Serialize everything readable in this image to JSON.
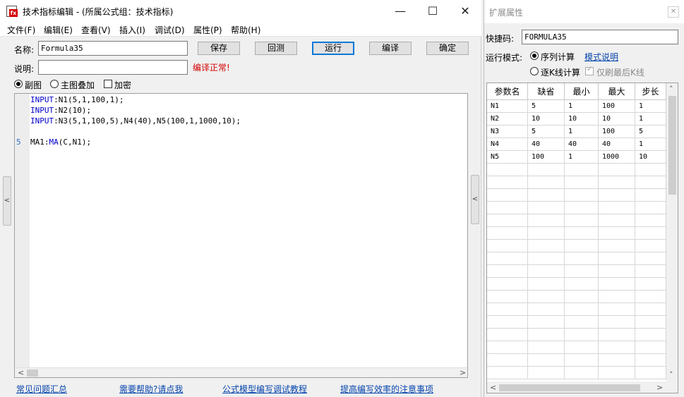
{
  "window": {
    "title": "技术指标编辑 - (所属公式组：技术指标)",
    "icon_badge": "fx",
    "minimize_glyph": "—",
    "maximize_glyph": "☐",
    "close_glyph": "✕"
  },
  "menu": [
    "文件(F)",
    "编辑(E)",
    "查看(V)",
    "插入(I)",
    "调试(D)",
    "属性(P)",
    "帮助(H)"
  ],
  "form": {
    "name_label": "名称:",
    "name_value": "Formula35",
    "desc_label": "说明:",
    "desc_value": "",
    "compile_status": "编译正常!",
    "compile_status_color": "#d40000"
  },
  "buttons": {
    "save": "保存",
    "rollback": "回测",
    "run": "运行",
    "compile": "编译",
    "ok": "确定"
  },
  "options": {
    "sub_chart": "副图",
    "main_overlay": "主图叠加",
    "encrypt": "加密",
    "selected": "副图"
  },
  "code": {
    "lines": [
      {
        "kw": "INPUT",
        "rest": ":N1(5,1,100,1);"
      },
      {
        "kw": "INPUT",
        "rest": ":N2(10);"
      },
      {
        "kw": "INPUT",
        "rest": ":N3(5,1,100,5),N4(40),N5(100,1,1000,10);"
      },
      {
        "kw": "",
        "rest": ""
      },
      {
        "prefix": "MA1:",
        "kw": "MA",
        "rest": "(C,N1);"
      }
    ],
    "line_number_label": "5",
    "keyword_color": "#0000c8"
  },
  "footer_links": [
    "常见问题汇总",
    "需要帮助?请点我",
    "公式模型编写调试教程",
    "提高编写效率的注意事项"
  ],
  "panel": {
    "title": "扩展属性",
    "close_glyph": "✕",
    "shortcut_label": "快捷码:",
    "shortcut_value": "FORMULA35",
    "run_mode_label": "运行模式:",
    "mode_sequence": "序列计算",
    "mode_help_link": "模式说明",
    "mode_tick": "逐K线计算",
    "refresh_last_only": "仅刷最后K线",
    "selected_mode": "序列计算",
    "grid": {
      "headers": [
        "参数名",
        "缺省",
        "最小",
        "最大",
        "步长"
      ],
      "rows": [
        [
          "N1",
          "5",
          "1",
          "100",
          "1"
        ],
        [
          "N2",
          "10",
          "10",
          "10",
          "1"
        ],
        [
          "N3",
          "5",
          "1",
          "100",
          "5"
        ],
        [
          "N4",
          "40",
          "40",
          "40",
          "1"
        ],
        [
          "N5",
          "100",
          "1",
          "1000",
          "10"
        ]
      ]
    }
  }
}
